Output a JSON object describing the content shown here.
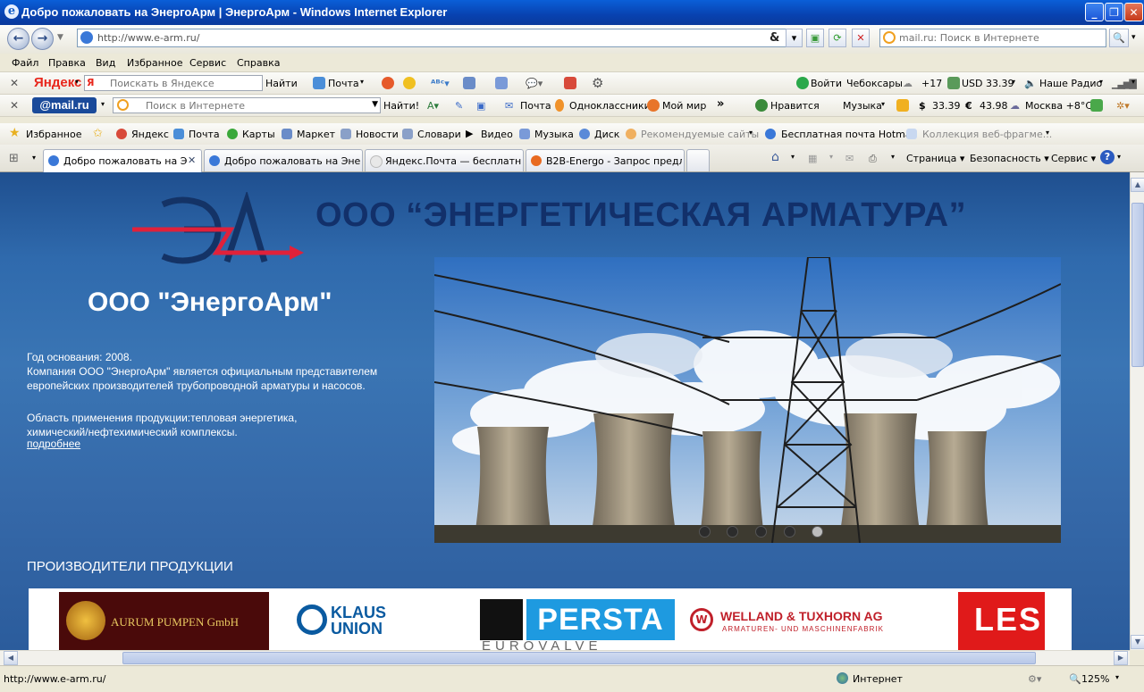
{
  "window": {
    "title": "Добро пожаловать на ЭнергоАрм | ЭнергоАрм - Windows Internet Explorer",
    "app_icon": "ie-icon"
  },
  "address": {
    "url": "http://www.e-arm.ru/",
    "search_placeholder": "mail.ru: Поиск в Интернете"
  },
  "menu": [
    "Файл",
    "Правка",
    "Вид",
    "Избранное",
    "Сервис",
    "Справка"
  ],
  "yandex_bar": {
    "brand": "Яндекс",
    "search_placeholder": "Поискать в Яндексе",
    "find": "Найти",
    "mail": "Почта",
    "login": "Войти",
    "city": "Чебоксары",
    "temp": "+17",
    "usd": "USD 33.39",
    "radio": "Наше Радио"
  },
  "mailru_bar": {
    "brand": "@mail.ru",
    "search_placeholder": "Поиск в Интернете",
    "find": "Найти!",
    "mail": "Почта",
    "odnoklassniki": "Одноклассники",
    "mymir": "Мой мир",
    "like": "Нравится",
    "music": "Музыка",
    "usd": "33.39",
    "eur": "43.98",
    "weather": "Москва +8°C"
  },
  "favorites_bar": {
    "favorites": "Избранное",
    "links": [
      "Яндекс",
      "Почта",
      "Карты",
      "Маркет",
      "Новости",
      "Словари",
      "Видео",
      "Музыка",
      "Диск",
      "Рекомендуемые сайты",
      "Бесплатная почта Hotmail",
      "Коллекция веб-фрагме..."
    ]
  },
  "tabs": [
    {
      "label": "Добро пожаловать на Э..."
    },
    {
      "label": "Добро пожаловать на Энер..."
    },
    {
      "label": "Яндекс.Почта — бесплатн..."
    },
    {
      "label": "B2B-Energo - Запрос предл..."
    }
  ],
  "command_bar": {
    "page": "Страница",
    "safety": "Безопасность",
    "tools": "Сервис"
  },
  "page": {
    "logo_letters": "ЭЛ",
    "header_title": "ООО “ЭНЕРГЕТИЧЕСКАЯ АРМАТУРА”",
    "company_name": "ООО \"ЭнергоАрм\"",
    "founded": "Год основания: 2008.",
    "about_line1": "Компания ООО \"ЭнергоАрм\" является официальным представителем",
    "about_line2": "европейских производителей трубопроводной арматуры и насосов.",
    "scope_line1": "Область применения продукции:тепловая энергетика,",
    "scope_line2": "химический/нефтехимический комплексы.",
    "more_link": "подробнее",
    "producers_heading": "ПРОИЗВОДИТЕЛИ ПРОДУКЦИИ",
    "slider_active_index": 5,
    "slider_dots": 5,
    "logos": [
      "AURUM PUMPEN GmbH",
      "KLAUS UNION",
      "PERSTA",
      "EUROVALVE",
      "WELLAND & TUXHORN AG",
      "ARMATUREN- UND MASCHINENFABRIK",
      "LES"
    ]
  },
  "status": {
    "url": "http://www.e-arm.ru/",
    "zone": "Интернет",
    "zoom": "125%"
  },
  "colors": {
    "titlebar": "#0842b0",
    "page_bg": "#3a75b4",
    "header_title": "#12306a",
    "logo_red": "#e0213a"
  }
}
